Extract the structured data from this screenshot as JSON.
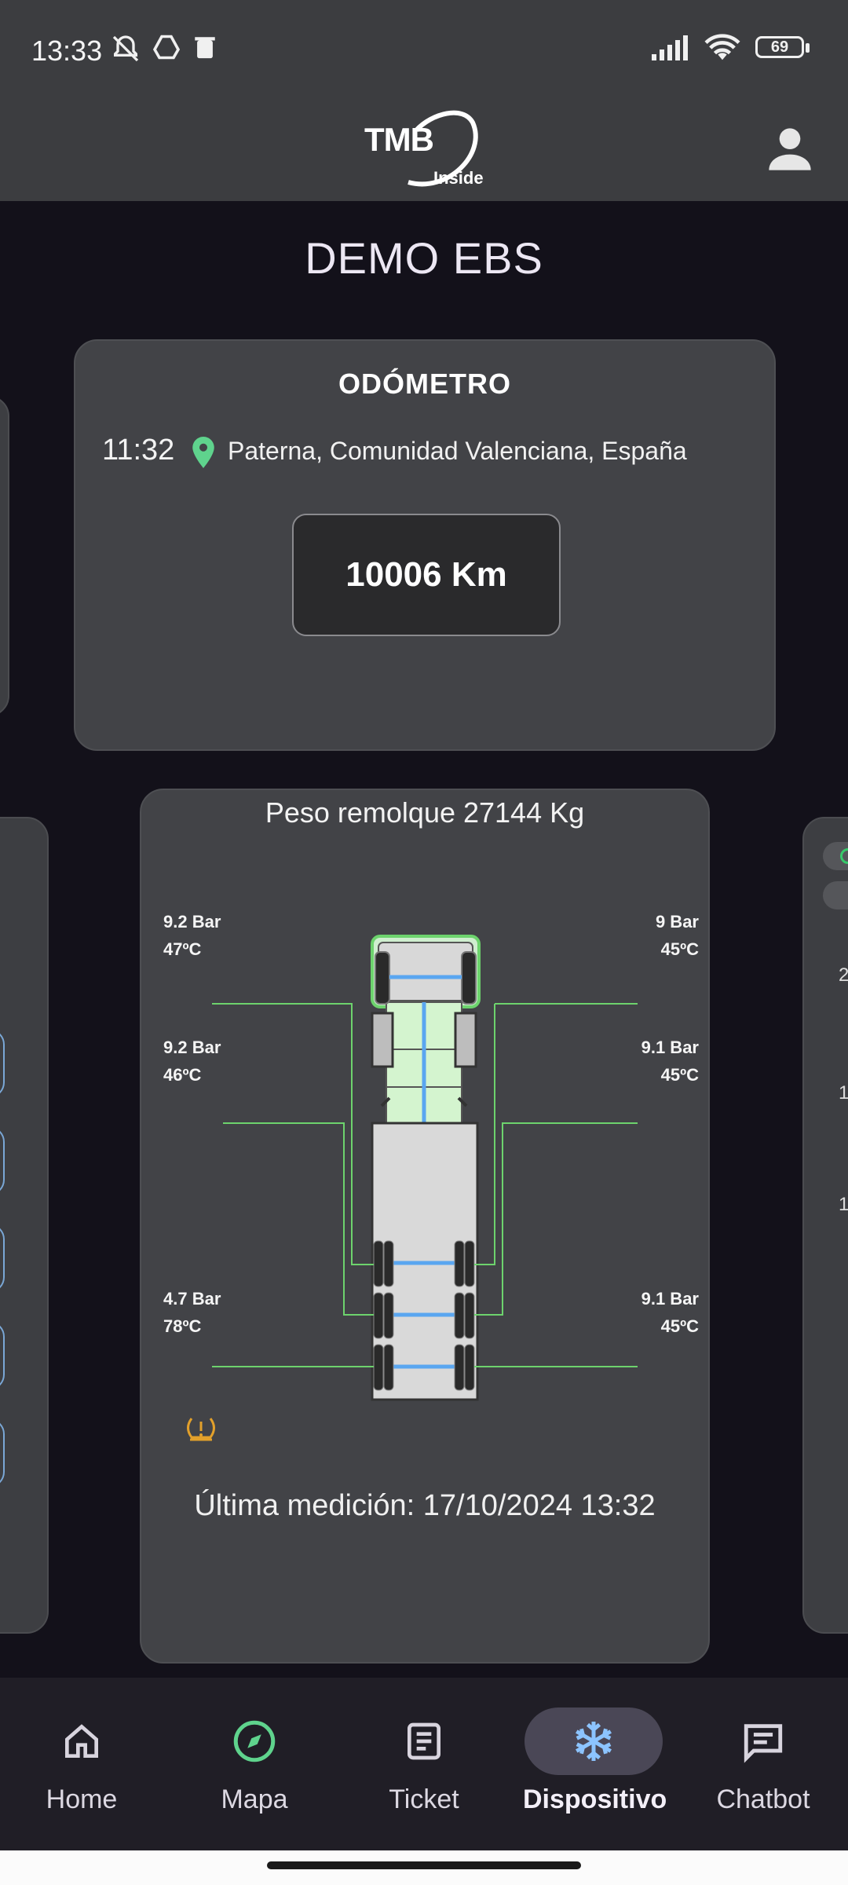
{
  "status_bar": {
    "time": "13:33",
    "battery": "69",
    "icons_left": [
      "bell-off-icon",
      "drive-icon",
      "trash-icon"
    ],
    "icons_right": [
      "signal-icon",
      "wifi-icon",
      "battery-icon"
    ]
  },
  "app_bar": {
    "logo_text": "TMB",
    "logo_subtext": "Inside",
    "profile_icon": "person-icon"
  },
  "page_title": "DEMO EBS",
  "odometer": {
    "title": "ODÓMETRO",
    "time": "11:32",
    "location": "Paterna, Comunidad Valenciana, España",
    "value": "10006 Km",
    "pin_color": "#5fd38d"
  },
  "truck": {
    "weight_label": "Peso remolque 27144 Kg",
    "tires": {
      "front_left": {
        "pressure": "9.2 Bar",
        "temp": "47ºC"
      },
      "front_right": {
        "pressure": "9 Bar",
        "temp": "45ºC"
      },
      "mid_left": {
        "pressure": "9.2 Bar",
        "temp": "46ºC"
      },
      "mid_right": {
        "pressure": "9.1 Bar",
        "temp": "45ºC"
      },
      "rear_left": {
        "pressure": "4.7 Bar",
        "temp": "78ºC"
      },
      "rear_right": {
        "pressure": "9.1 Bar",
        "temp": "45ºC"
      }
    },
    "last_measurement": "Última medición: 17/10/2024  13:32",
    "warning_color": "#e2a02b",
    "line_color": "#6dd36d",
    "axle_color": "#5aa6f0"
  },
  "right_peek": {
    "numbers": [
      "2",
      "1",
      "1"
    ]
  },
  "bottom_nav": {
    "items": [
      {
        "label": "Home",
        "icon": "home-icon"
      },
      {
        "label": "Mapa",
        "icon": "compass-icon"
      },
      {
        "label": "Ticket",
        "icon": "ticket-icon"
      },
      {
        "label": "Dispositivo",
        "icon": "snowflake-icon"
      },
      {
        "label": "Chatbot",
        "icon": "chat-icon"
      }
    ],
    "active_index": 3
  }
}
